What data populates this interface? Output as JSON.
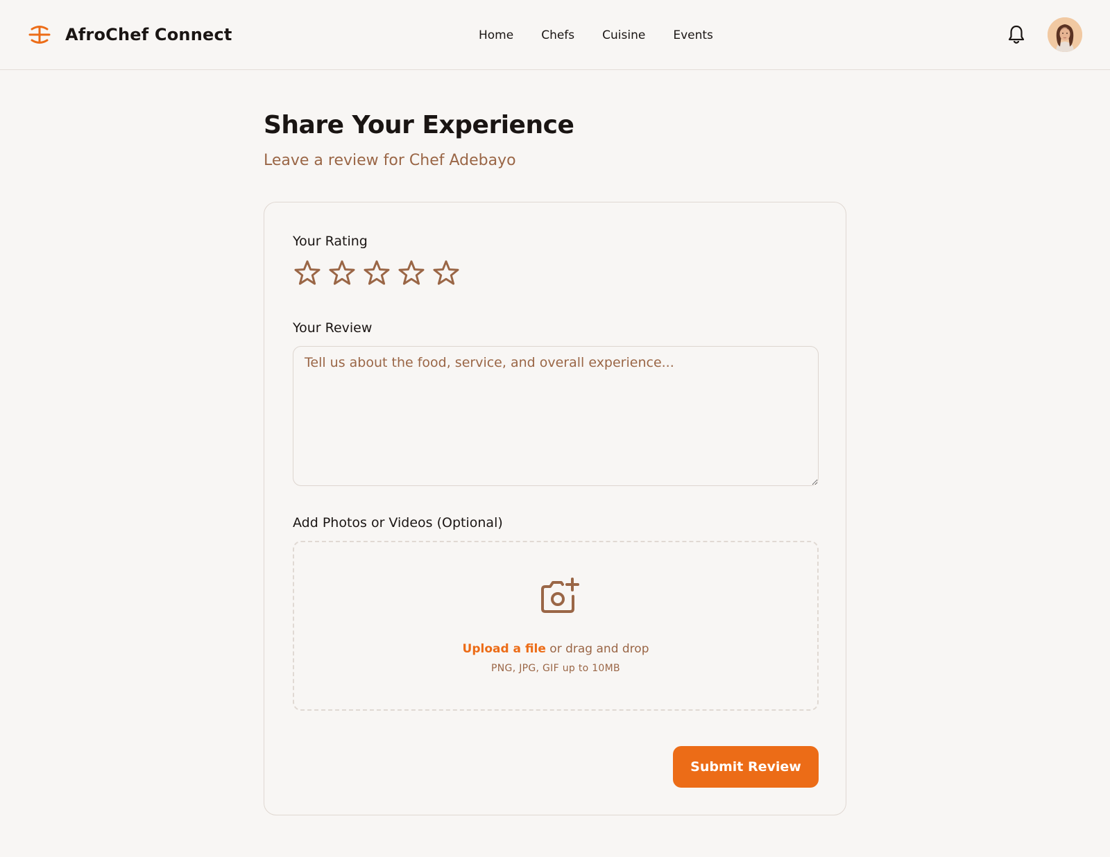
{
  "header": {
    "brand_name": "AfroChef Connect",
    "brand_icon": "afrochef-logo-icon",
    "nav": [
      {
        "label": "Home"
      },
      {
        "label": "Chefs"
      },
      {
        "label": "Cuisine"
      },
      {
        "label": "Events"
      }
    ],
    "notification_icon": "bell-icon",
    "avatar_icon": "user-avatar"
  },
  "page": {
    "title": "Share Your Experience",
    "subtitle": "Leave a review for Chef Adebayo"
  },
  "form": {
    "rating_label": "Your Rating",
    "rating_value": 0,
    "rating_max": 5,
    "review_label": "Your Review",
    "review_value": "",
    "review_placeholder": "Tell us about the food, service, and overall experience...",
    "media_label": "Add Photos or Videos (Optional)",
    "upload_icon": "camera-plus-icon",
    "upload_link": "Upload a file",
    "upload_rest": " or drag and drop",
    "upload_hint": "PNG, JPG, GIF up to 10MB",
    "submit_label": "Submit Review"
  },
  "colors": {
    "accent": "#ec6c17",
    "muted_brown": "#9a6646",
    "background": "#f8f6f4",
    "text": "#1a1513"
  }
}
